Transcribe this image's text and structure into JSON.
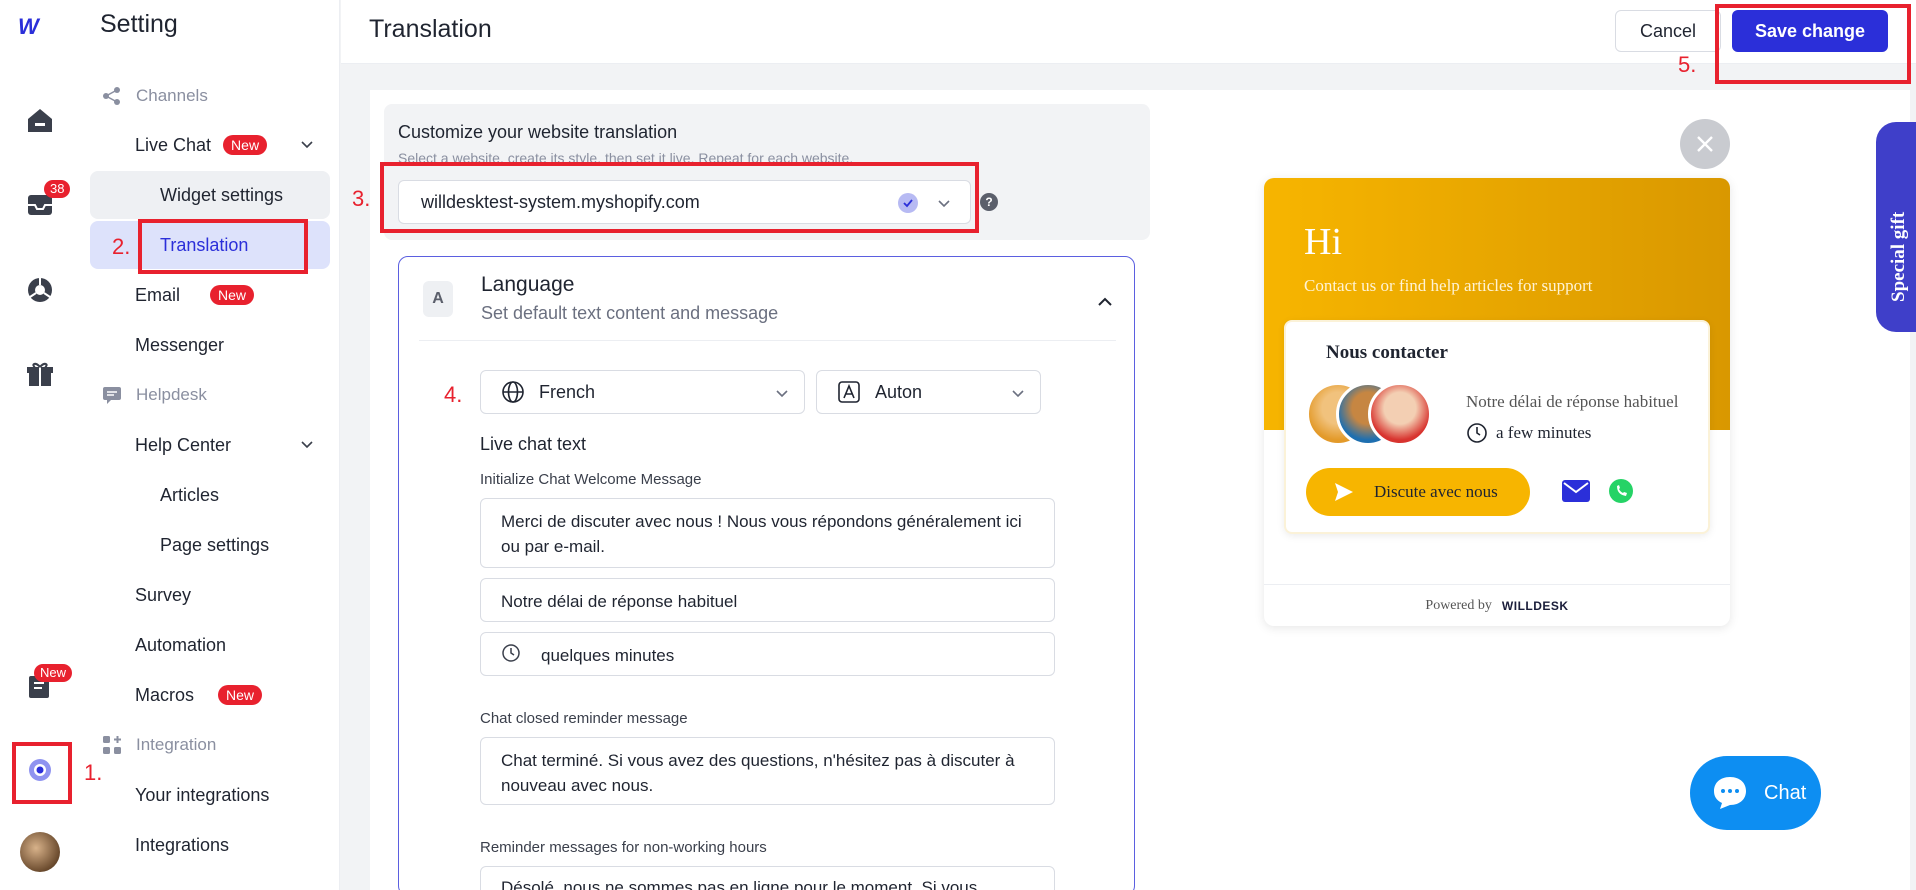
{
  "rail": {
    "inbox_badge": "38",
    "tasks_badge": "New"
  },
  "sidebar": {
    "title": "Setting",
    "channels": "Channels",
    "live_chat": "Live Chat",
    "widget_settings": "Widget settings",
    "translation": "Translation",
    "email": "Email",
    "messenger": "Messenger",
    "helpdesk": "Helpdesk",
    "help_center": "Help Center",
    "articles": "Articles",
    "page_settings": "Page settings",
    "survey": "Survey",
    "automation": "Automation",
    "macros": "Macros",
    "integration": "Integration",
    "your_integrations": "Your integrations",
    "integrations": "Integrations",
    "new_badge": "New"
  },
  "header": {
    "title": "Translation",
    "cancel": "Cancel",
    "save": "Save change"
  },
  "customize": {
    "title": "Customize your website translation",
    "subtitle": "Select a website, create its style, then set it live. Repeat for each website.",
    "website": "willdesktest-system.myshopify.com",
    "help": "?"
  },
  "language": {
    "title": "Language",
    "subtitle": "Set default text content and message",
    "selected_language": "French",
    "selected_mode": "Auton",
    "live_chat_text": "Live chat text",
    "welcome_label": "Initialize Chat Welcome Message",
    "welcome_value": "Merci de discuter avec nous ! Nous vous répondons généralement ici ou par e-mail.",
    "response_value": "Notre délai de réponse habituel",
    "minutes_value": "quelques minutes",
    "closed_label": "Chat closed reminder message",
    "closed_value": "Chat terminé. Si vous avez des questions, n'hésitez pas à discuter à nouveau avec nous.",
    "nonworking_label": "Reminder messages for non-working hours",
    "nonworking_value": "Désolé, nous ne sommes pas en ligne pour le moment. Si vous"
  },
  "preview": {
    "hi": "Hi",
    "tagline": "Contact us or find help articles for support",
    "contact_title": "Nous contacter",
    "response_time": "Notre délai de réponse habituel",
    "few_minutes": "a few minutes",
    "chat_button": "Discute avec nous",
    "powered_by": "Powered by",
    "brand": "WILLDESK"
  },
  "fab": {
    "label": "Chat"
  },
  "gift": {
    "label": "Special gift"
  },
  "steps": {
    "s1": "1.",
    "s2": "2.",
    "s3": "3.",
    "s4": "4.",
    "s5": "5."
  },
  "colors": {
    "accent": "#2b2fd9",
    "annotation": "#e8212e",
    "widget": "#f7b500",
    "fab": "#0d8ef2"
  }
}
